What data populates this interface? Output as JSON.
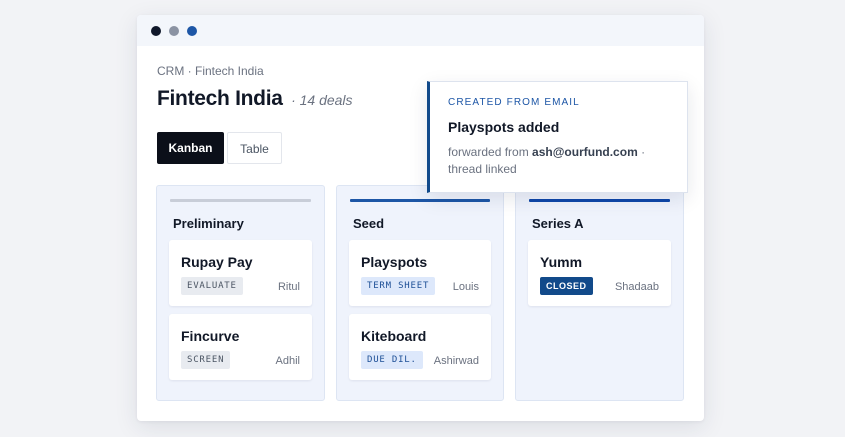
{
  "breadcrumb": "CRM · Fintech India",
  "page": {
    "title": "Fintech India",
    "count": "· 14 deals"
  },
  "views": {
    "kanban": "Kanban",
    "table": "Table"
  },
  "toast": {
    "eyebrow": "CREATED FROM EMAIL",
    "title": "Playspots added",
    "prefix": "forwarded from ",
    "email": "ash@ourfund.com",
    "suffix": " · thread linked"
  },
  "columns": [
    {
      "title": "Preliminary",
      "bar_color": "#c8cdd8",
      "cards": [
        {
          "title": "Rupay Pay",
          "badge": "EVALUATE",
          "owner": "Ritul"
        },
        {
          "title": "Fincurve",
          "badge": "SCREEN",
          "owner": "Adhil"
        }
      ]
    },
    {
      "title": "Seed",
      "bar_color": "#1d56a6",
      "cards": [
        {
          "title": "Playspots",
          "badge": "TERM SHEET",
          "owner": "Louis"
        },
        {
          "title": "Kiteboard",
          "badge": "DUE DIL.",
          "owner": "Ashirwad"
        }
      ]
    },
    {
      "title": "Series A",
      "bar_color": "#0e46a8",
      "cards": [
        {
          "title": "Yumm",
          "badge": "CLOSED",
          "owner": "Shadaab"
        }
      ]
    }
  ],
  "colors": {
    "accent": "#124a8a",
    "badge_gray": "#e8ebf0",
    "badge_blue": "#dde8fb"
  }
}
